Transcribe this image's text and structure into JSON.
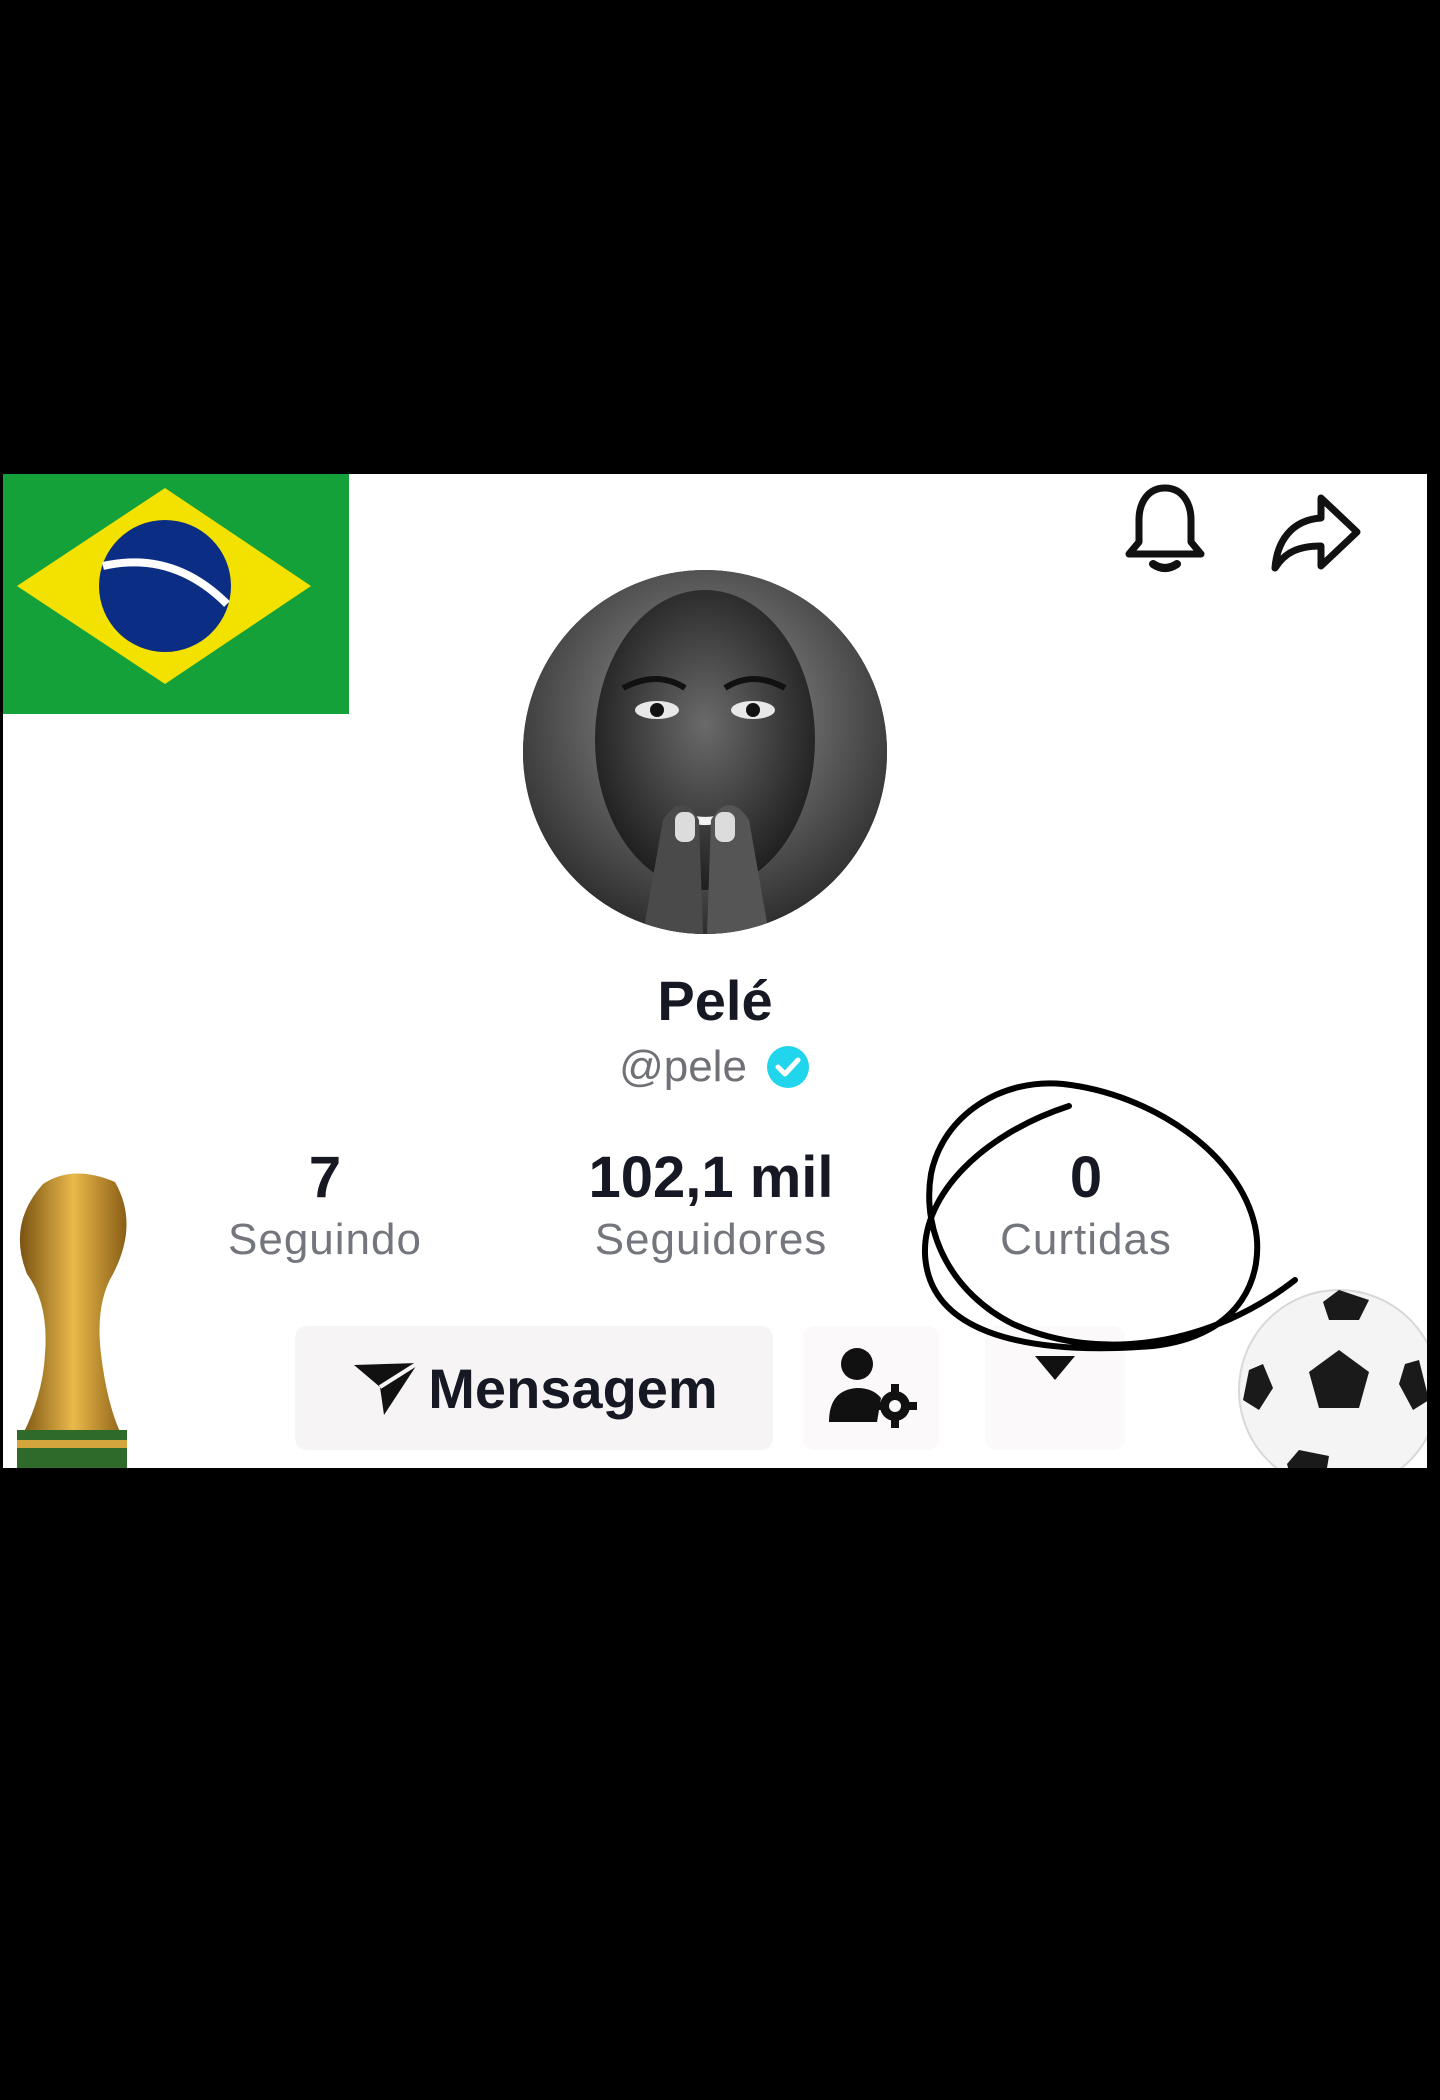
{
  "profile": {
    "display_name": "Pelé",
    "handle": "@pele",
    "verified": true,
    "avatar_alt": "profile photo"
  },
  "stats": [
    {
      "value": "7",
      "label": "Seguindo"
    },
    {
      "value": "102,1 mil",
      "label": "Seguidores"
    },
    {
      "value": "0",
      "label": "Curtidas"
    }
  ],
  "actions": {
    "message_label": "Mensagem"
  },
  "icons": {
    "top_right": [
      "bell-icon",
      "share-icon"
    ],
    "message": "send-icon",
    "settings": "user-settings-icon",
    "dropdown": "caret-down-icon",
    "decorations": [
      "brazil-flag",
      "world-cup-trophy",
      "soccer-ball",
      "hand-drawn-circle"
    ]
  },
  "colors": {
    "verified": "#20d5ec",
    "flag_green": "#14a13a",
    "flag_yellow": "#f3e100",
    "flag_blue": "#0b2d84",
    "scribble": "#000000"
  }
}
